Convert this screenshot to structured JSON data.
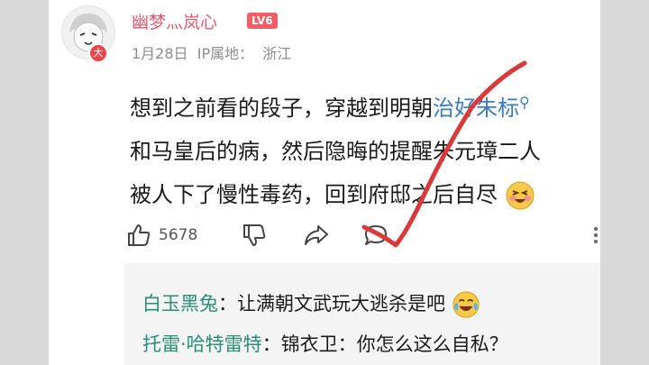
{
  "comment": {
    "username": "幽梦灬岚心",
    "level": "LV6",
    "avatar_badge": "大",
    "date": "1月28日",
    "ip_label": "IP属地：",
    "ip_location": "浙江",
    "content": {
      "line1_prefix": "想到之前看的段子，穿越到明朝",
      "line1_link": "治好朱标",
      "line2": "和马皇后的病，然后隐晦的提醒朱元璋二人",
      "line3": "被人下了慢性毒药，回到府邸之后自尽"
    },
    "likes": "5678"
  },
  "replies": [
    {
      "name": "白玉黑兔",
      "text": "：让满朝文武玩大逃杀是吧"
    },
    {
      "name": "托雷·哈特雷特",
      "text": "：锦衣卫：你怎么这么自私？"
    }
  ],
  "icons": {
    "search": "search-icon",
    "like": "thumb-up-icon",
    "dislike": "thumb-down-icon",
    "share": "share-icon",
    "reply": "comment-bubble-icon",
    "more": "more-icon"
  },
  "colors": {
    "username": "#e65a6d",
    "level_badge": "#f25d66",
    "link": "#3b7bc2",
    "reply_name": "#2a8f72",
    "checkmark": "#d83a3a"
  }
}
